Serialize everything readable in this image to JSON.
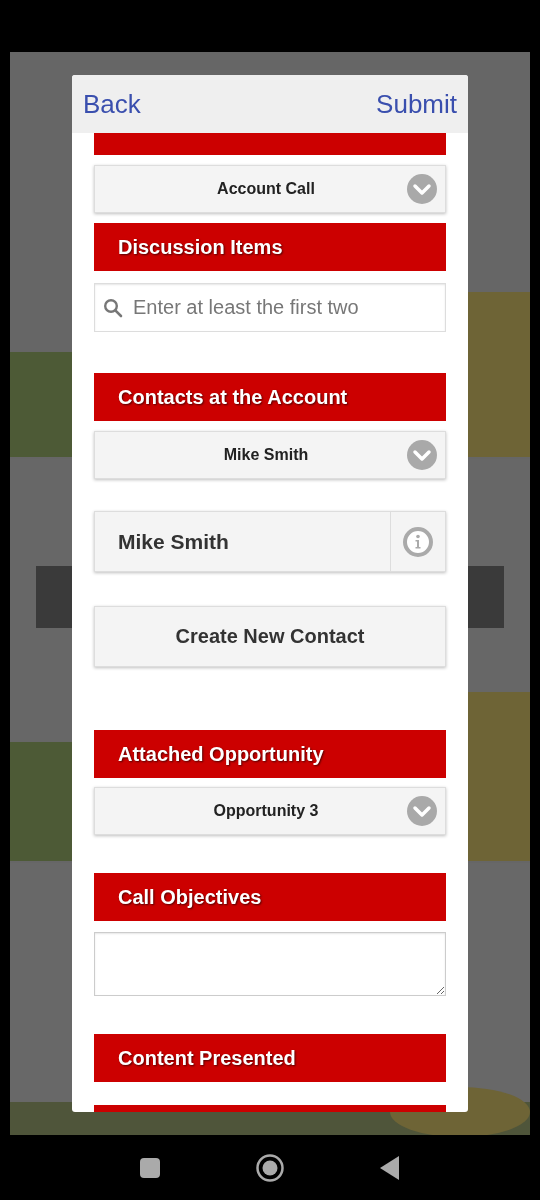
{
  "modal_header": {
    "back": "Back",
    "submit": "Submit"
  },
  "form": [
    {
      "kind": "section"
    },
    {
      "kind": "select",
      "value": "Account Call"
    },
    {
      "kind": "section",
      "label": "Discussion Items"
    },
    {
      "kind": "search",
      "placeholder": "Enter at least the first two"
    },
    {
      "kind": "section",
      "label": "Contacts at the Account"
    },
    {
      "kind": "select",
      "value": "Mike Smith"
    },
    {
      "kind": "contact",
      "name": "Mike Smith"
    },
    {
      "kind": "button",
      "label": "Create New Contact"
    },
    {
      "kind": "section",
      "label": "Attached Opportunity"
    },
    {
      "kind": "select",
      "value": "Opportunity 3"
    },
    {
      "kind": "section",
      "label": "Call Objectives"
    },
    {
      "kind": "textarea"
    },
    {
      "kind": "section",
      "label": "Content Presented"
    },
    {
      "kind": "section"
    }
  ]
}
